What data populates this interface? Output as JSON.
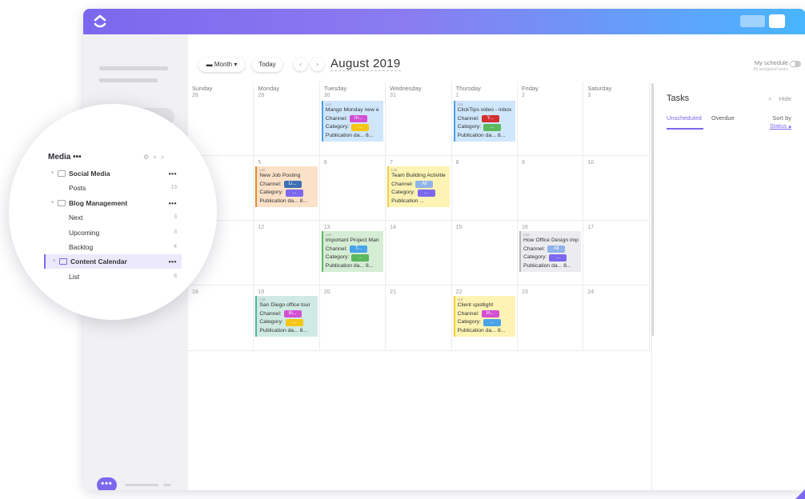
{
  "colors": {
    "accent": "#7b68ee",
    "topbar_start": "#7b68ee",
    "topbar_end": "#49b6ff"
  },
  "toolbar": {
    "view_label": "Month",
    "today_label": "Today",
    "prev_label": "‹",
    "next_label": "›",
    "month_title": "August 2019",
    "my_schedule": "My schedule",
    "my_schedule_sub": "All assigned tasks"
  },
  "calendar": {
    "days": [
      "Sunday",
      "Monday",
      "Tuesday",
      "Wednesday",
      "Thursday",
      "Friday",
      "Saturday"
    ],
    "weeks": [
      [
        "28",
        "29",
        "30",
        "31",
        "1",
        "2",
        "3"
      ],
      [
        "",
        "5",
        "6",
        "7",
        "8",
        "9",
        "10"
      ],
      [
        "",
        "12",
        "13",
        "14",
        "15",
        "16",
        "17"
      ],
      [
        "18",
        "19",
        "20",
        "21",
        "22",
        "23",
        "24"
      ]
    ],
    "cards": [
      {
        "week": 0,
        "day": 2,
        "list": "List",
        "title": "Mango Monday new e",
        "channel": "In...",
        "channel_color": "#d44fd4",
        "category": "...",
        "category_color": "#f5c518",
        "pub": "Publication da... 8...",
        "bg": "#cfe6fb",
        "border": "#4a9fe8"
      },
      {
        "week": 0,
        "day": 4,
        "list": "List",
        "title": "ClickTips video - inbox",
        "channel": "Y...",
        "channel_color": "#d33030",
        "category": "...",
        "category_color": "#5cb85c",
        "pub": "Publication da... 8...",
        "bg": "#cfe6fb",
        "border": "#4a9fe8"
      },
      {
        "week": 1,
        "day": 1,
        "list": "List",
        "title": "New Job Posting",
        "channel": "Li...",
        "channel_color": "#3f6fb5",
        "category": "...",
        "category_color": "#7b68ee",
        "pub": "Publication da... 8...",
        "bg": "#fbe1c8",
        "border": "#e68a2e"
      },
      {
        "week": 1,
        "day": 3,
        "list": "List",
        "title": "Team Building Activitie",
        "channel": "All",
        "channel_color": "#8fb3ea",
        "category": "...",
        "category_color": "#7b68ee",
        "pub": "Publication ...",
        "bg": "#fdf3b4",
        "border": "#f0cf37"
      },
      {
        "week": 2,
        "day": 2,
        "list": "List",
        "title": "Important Project Man",
        "channel": "T...",
        "channel_color": "#4aa3e8",
        "category": "...",
        "category_color": "#5cb85c",
        "pub": "Publication da... 8...",
        "bg": "#d5ecd5",
        "border": "#5cb85c"
      },
      {
        "week": 2,
        "day": 5,
        "list": "List",
        "title": "How Office Design imp",
        "channel": "All",
        "channel_color": "#8fb3ea",
        "category": "...",
        "category_color": "#7b68ee",
        "pub": "Publication da... 8...",
        "bg": "#ececef",
        "border": "#b5b5bb"
      },
      {
        "week": 3,
        "day": 1,
        "list": "List",
        "title": "San Diego office tour",
        "channel": "In...",
        "channel_color": "#d44fd4",
        "category": "...",
        "category_color": "#f5c518",
        "pub": "Publication da... 8...",
        "bg": "#cfeae2",
        "border": "#4cb79a"
      },
      {
        "week": 3,
        "day": 4,
        "list": "List",
        "title": "Client spotlight",
        "channel": "In...",
        "channel_color": "#d44fd4",
        "category": "...",
        "category_color": "#4aa3e8",
        "pub": "Publication da... 8...",
        "bg": "#fdf3b4",
        "border": "#f0cf37"
      }
    ],
    "channel_label": "Channel:",
    "category_label": "Category:"
  },
  "tasks": {
    "title": "Tasks",
    "hide": "Hide",
    "tab_unscheduled": "Unscheduled",
    "tab_overdue": "Overdue",
    "sort_by": "Sort by",
    "sort_value": "Status ▴"
  },
  "sidebar": {
    "space_name": "Media •••",
    "items": [
      {
        "label": "Social Media",
        "bold": true,
        "folder": true,
        "right": "•••"
      },
      {
        "label": "Posts",
        "bold": false,
        "folder": false,
        "right": "13"
      },
      {
        "label": "Blog Management",
        "bold": true,
        "folder": true,
        "right": "•••"
      },
      {
        "label": "Next",
        "bold": false,
        "folder": false,
        "right": "3"
      },
      {
        "label": "Upcoming",
        "bold": false,
        "folder": false,
        "right": "3"
      },
      {
        "label": "Backlog",
        "bold": false,
        "folder": false,
        "right": "4"
      },
      {
        "label": "Content Calendar",
        "bold": true,
        "folder": true,
        "right": "•••",
        "active": true
      },
      {
        "label": "List",
        "bold": false,
        "folder": false,
        "right": "8"
      }
    ]
  }
}
